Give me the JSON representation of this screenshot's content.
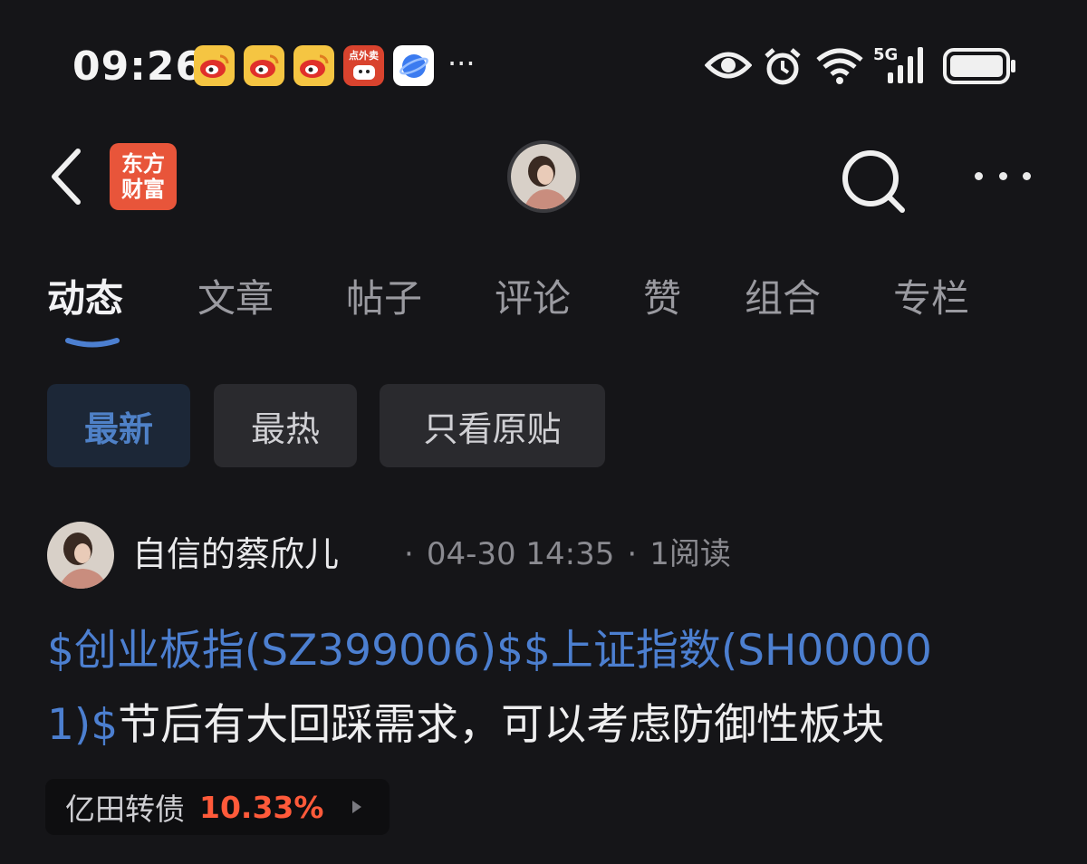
{
  "status_bar": {
    "time": "09:26",
    "notifications": [
      "weibo-icon",
      "weibo-icon",
      "weibo-icon",
      "food-delivery-icon",
      "browser-icon"
    ],
    "food_app_label": "点外卖",
    "more": "···",
    "network": "5G"
  },
  "header": {
    "app_logo_line1": "东方",
    "app_logo_line2": "财富"
  },
  "tabs": [
    {
      "label": "动态",
      "active": true
    },
    {
      "label": "文章",
      "active": false
    },
    {
      "label": "帖子",
      "active": false
    },
    {
      "label": "评论",
      "active": false
    },
    {
      "label": "赞",
      "active": false
    },
    {
      "label": "组合",
      "active": false
    },
    {
      "label": "专栏",
      "active": false
    }
  ],
  "filters": [
    {
      "label": "最新",
      "active": true
    },
    {
      "label": "最热",
      "active": false
    },
    {
      "label": "只看原贴",
      "active": false
    }
  ],
  "post": {
    "author": "自信的蔡欣儿",
    "date": "04-30 14:35",
    "reads": "1阅读",
    "line1_link": "$创业板指(SZ399006)$$上证指数(SH00000",
    "line2_link": "1)$",
    "line2_text": "节后有大回踩需求，可以考虑防御性板块",
    "stock_tag": {
      "name": "亿田转债",
      "change": "10.33%"
    }
  },
  "colors": {
    "background": "#151518",
    "accent_blue": "#4c7fd0",
    "up_red": "#ff5a3a",
    "logo_orange": "#e8553a"
  }
}
